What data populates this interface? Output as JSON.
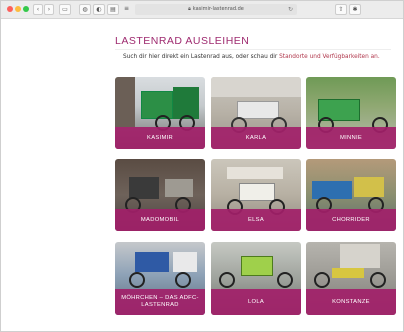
{
  "browser": {
    "url": "kasimir-lastenrad.de"
  },
  "page": {
    "title": "LASTENRAD AUSLEIHEN",
    "intro_text": "Such dir hier direkt ein Lastenrad aus, oder schau dir",
    "intro_link": "Standorte und Verfügbarkeiten an."
  },
  "bikes": [
    {
      "name": "KASIMIR"
    },
    {
      "name": "KARLA"
    },
    {
      "name": "MINNIE"
    },
    {
      "name": "MADOMOBIL"
    },
    {
      "name": "ELSA"
    },
    {
      "name": "CHORRIDER"
    },
    {
      "name": "MÖHRCHEN – DAS ADFC-LASTENRAD"
    },
    {
      "name": "LOLA"
    },
    {
      "name": "KONSTANZE"
    }
  ],
  "colors": {
    "accent": "#9e2a6f",
    "label_band": "#a21f69",
    "link": "#b0364b"
  }
}
